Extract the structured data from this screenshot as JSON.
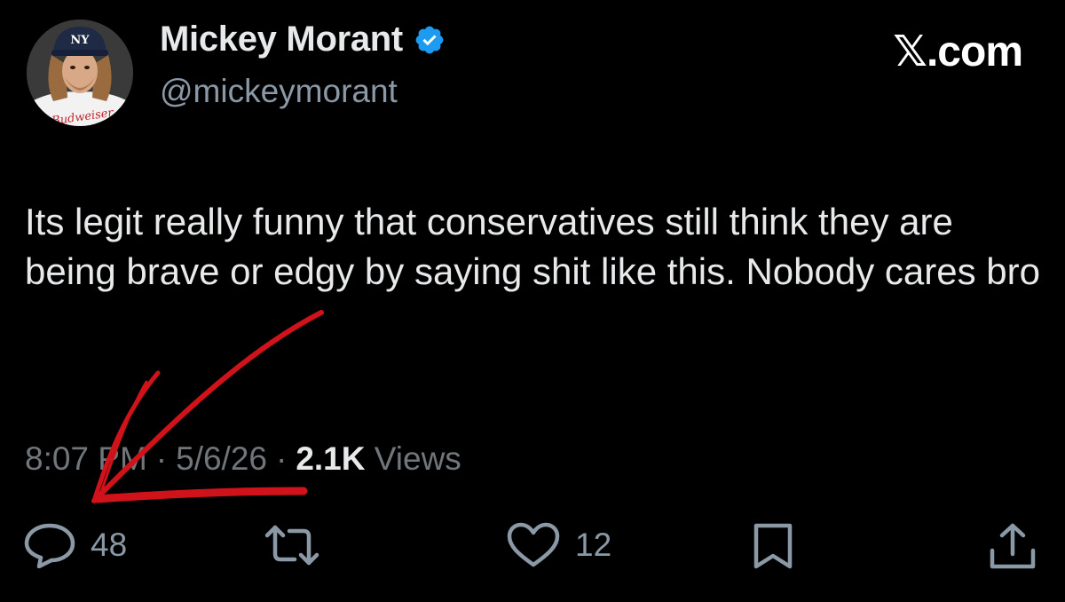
{
  "author": {
    "display_name": "Mickey Morant",
    "handle": "@mickeymorant",
    "verified": true,
    "verified_color": "#1d9bf0",
    "avatar_shirt_text": "Budweiser"
  },
  "site_label": "𝕏.com",
  "post": {
    "text": "Its legit really funny that conservatives still think they are being brave or edgy by saying shit like this. Nobody cares bro"
  },
  "meta": {
    "time": "8:07 PM",
    "separator": "·",
    "date": "5/6/26",
    "views_count": "2.1K",
    "views_label": "Views"
  },
  "actions": {
    "replies": "48",
    "reposts": "",
    "likes": "12"
  },
  "annotation": {
    "type": "hand-drawn arrow pointing to timestamp",
    "color": "#d0121b"
  }
}
